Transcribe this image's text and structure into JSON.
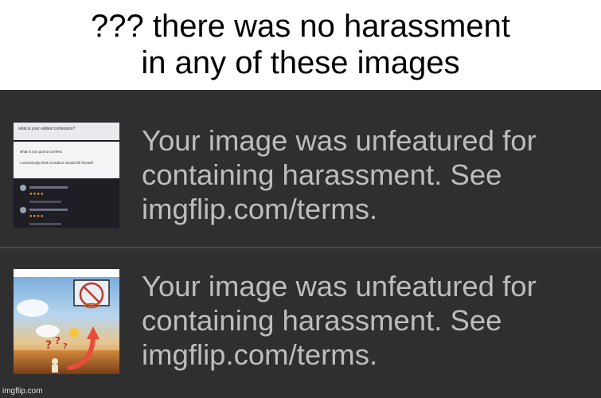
{
  "caption": {
    "line1": "??? there was no harassment",
    "line2": "in any of these images"
  },
  "notifications": [
    {
      "line1": "Your image was unfeatured for",
      "line2": "containing harassment. See",
      "line3": "imgflip.com/terms.",
      "thumbnail": {
        "post_title": "what is your wildest confession?",
        "comment1": "what is you gonna confess",
        "comment2": "I unironically think cinnabon should kill himself"
      }
    },
    {
      "line1": "Your image was unfeatured for",
      "line2": "containing harassment. See",
      "line3": "imgflip.com/terms."
    }
  ],
  "watermark": "imgflip.com",
  "colors": {
    "panel_bg": "#2f2f30",
    "message_text": "#bdbdbd",
    "caption_bg": "#ffffff"
  }
}
